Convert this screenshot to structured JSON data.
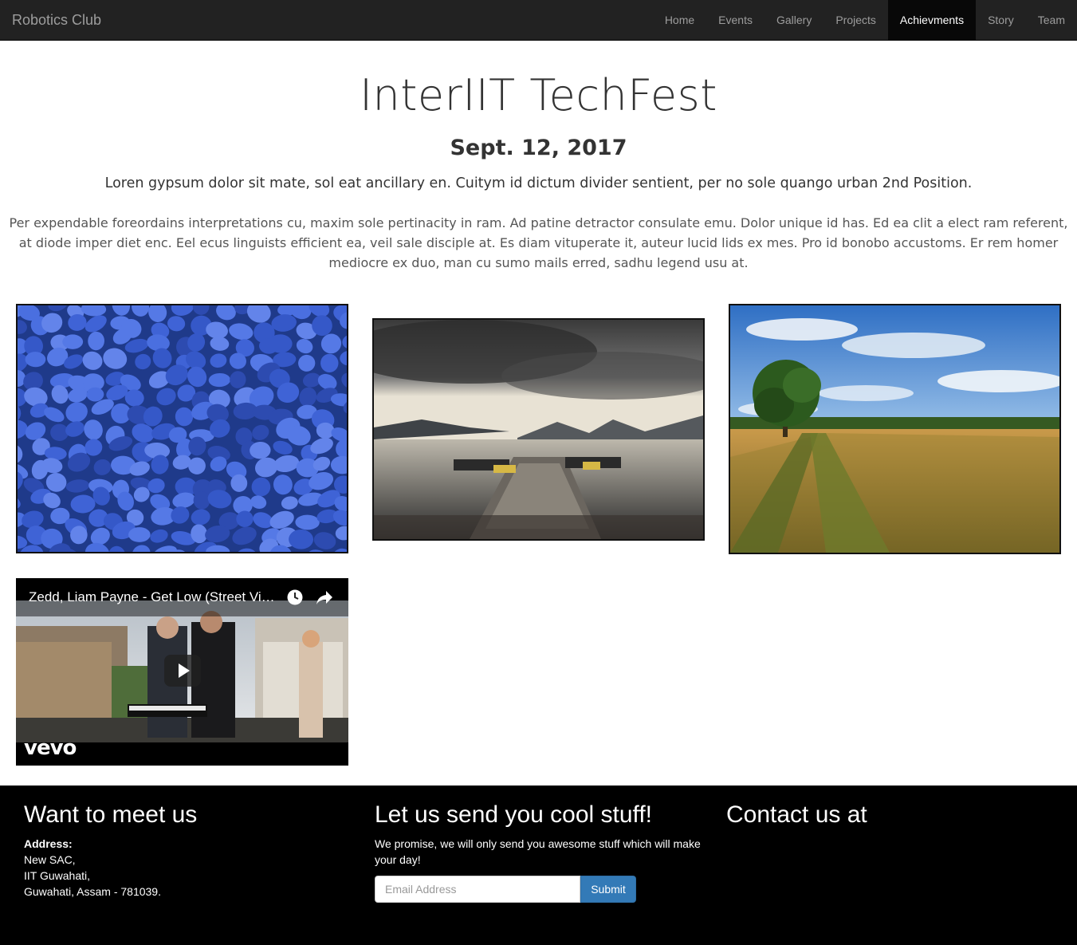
{
  "navbar": {
    "brand": "Robotics Club",
    "items": [
      {
        "label": "Home",
        "active": false
      },
      {
        "label": "Events",
        "active": false
      },
      {
        "label": "Gallery",
        "active": false
      },
      {
        "label": "Projects",
        "active": false
      },
      {
        "label": "Achievments",
        "active": true
      },
      {
        "label": "Story",
        "active": false
      },
      {
        "label": "Team",
        "active": false
      }
    ]
  },
  "main": {
    "title": "InterIIT TechFest",
    "date": "Sept. 12, 2017",
    "lead": "Loren gypsum dolor sit mate, sol eat ancillary en. Cuitym id dictum divider sentient, per no sole quango urban 2nd Position.",
    "paragraph": "Per expendable foreordains interpretations cu, maxim sole pertinacity in ram. Ad patine detractor consulate emu. Dolor unique id has. Ed ea clit a elect ram referent, at diode imper diet enc. Eel ecus linguists efficient ea, veil sale disciple at. Es diam vituperate it, auteur lucid lids ex mes. Pro id bonobo accustoms. Er rem homer mediocre ex duo, man cu sumo mails erred, sadhu legend usu at."
  },
  "gallery": {
    "images": [
      {
        "name": "blue-stones-photo"
      },
      {
        "name": "lake-dock-photo"
      },
      {
        "name": "field-path-photo"
      }
    ]
  },
  "video": {
    "title": "Zedd, Liam Payne - Get Low (Street Video)",
    "brand": "vevo"
  },
  "footer": {
    "col1": {
      "heading": "Want to meet us",
      "address_label": "Address:",
      "address_lines": [
        "New SAC,",
        "IIT Guwahati,",
        "Guwahati, Assam - 781039."
      ]
    },
    "col2": {
      "heading": "Let us send you cool stuff!",
      "text": "We promise, we will only send you awesome stuff which will make your day!",
      "email_placeholder": "Email Address",
      "submit_label": "Submit"
    },
    "col3": {
      "heading": "Contact us at"
    }
  },
  "colors": {
    "navbar_bg": "#222222",
    "active_bg": "#080808",
    "footer_bg": "#000000",
    "button": "#337ab7"
  }
}
